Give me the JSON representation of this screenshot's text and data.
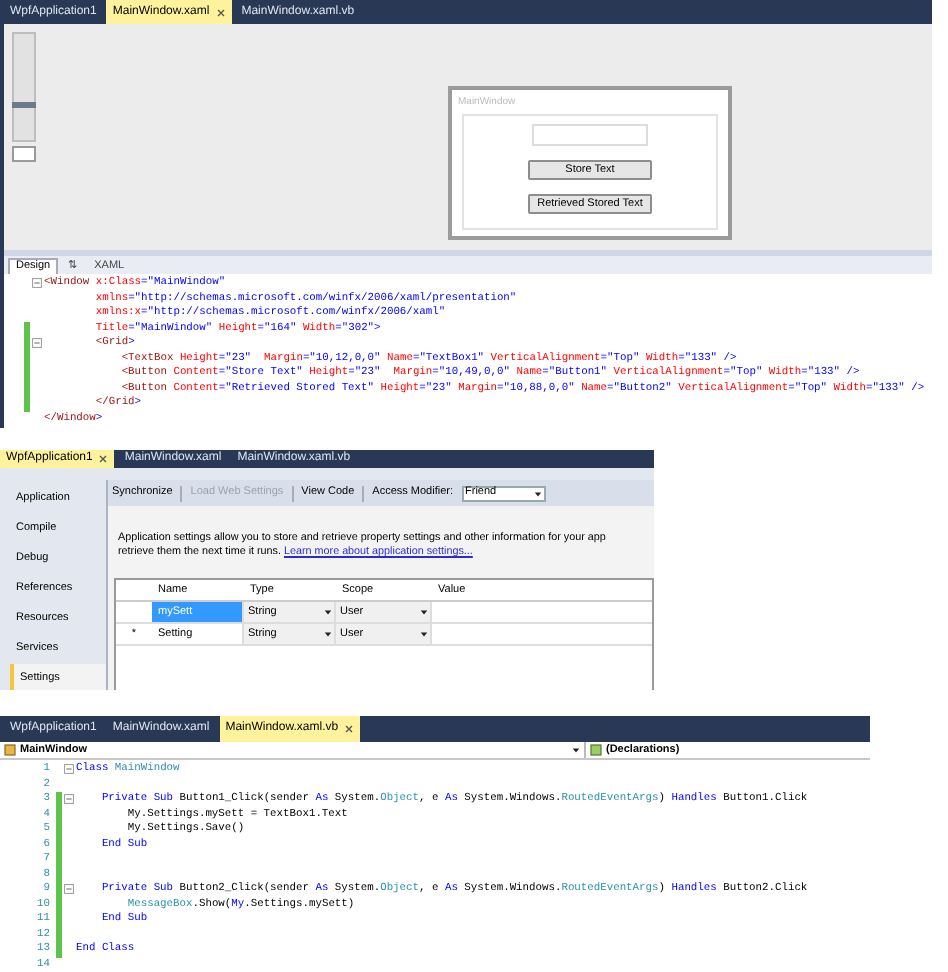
{
  "designer_panel": {
    "tabs": [
      {
        "label": "WpfApplication1",
        "selected": false
      },
      {
        "label": "MainWindow.xaml",
        "selected": true
      },
      {
        "label": "MainWindow.xaml.vb",
        "selected": false
      }
    ],
    "zoom_slider": {
      "level": 0.31
    },
    "design_window": {
      "title": "MainWindow",
      "buttons": [
        "Store Text",
        "Retrieved Stored Text"
      ]
    },
    "view_tabs": [
      {
        "label": "Design",
        "selected": true
      },
      {
        "label": "⇅",
        "selected": false
      },
      {
        "label": "XAML",
        "selected": false
      }
    ],
    "xaml_lines": [
      {
        "outline": true,
        "modified": false,
        "tokens": [
          {
            "kind": "tag",
            "text": "<Window"
          },
          {
            "kind": "attr",
            "text": " x:Class"
          },
          {
            "kind": "value",
            "text": "=\"MainWindow\""
          }
        ]
      },
      {
        "outline": false,
        "modified": false,
        "tokens": [
          {
            "kind": "attr",
            "text": "        xmlns"
          },
          {
            "kind": "value",
            "text": "=\"http://schemas.microsoft.com/winfx/2006/xaml/presentation\""
          }
        ]
      },
      {
        "outline": false,
        "modified": false,
        "tokens": [
          {
            "kind": "attr",
            "text": "        xmlns:x"
          },
          {
            "kind": "value",
            "text": "=\"http://schemas.microsoft.com/winfx/2006/xaml\""
          }
        ]
      },
      {
        "outline": false,
        "modified": true,
        "tokens": [
          {
            "kind": "attr",
            "text": "        Title"
          },
          {
            "kind": "value",
            "text": "=\"MainWindow\""
          },
          {
            "kind": "attr",
            "text": " Height"
          },
          {
            "kind": "value",
            "text": "=\"164\""
          },
          {
            "kind": "attr",
            "text": " Width"
          },
          {
            "kind": "value",
            "text": "=\"302\">"
          }
        ]
      },
      {
        "outline": true,
        "modified": true,
        "tokens": [
          {
            "kind": "tag",
            "text": "        <Grid"
          },
          {
            "kind": "punct",
            "text": ">"
          }
        ]
      },
      {
        "outline": false,
        "modified": true,
        "tokens": [
          {
            "kind": "tag",
            "text": "            <TextBox"
          },
          {
            "kind": "attr",
            "text": " Height"
          },
          {
            "kind": "value",
            "text": "=\"23\""
          },
          {
            "kind": "attr",
            "text": "  Margin"
          },
          {
            "kind": "value",
            "text": "=\"10,12,0,0\""
          },
          {
            "kind": "attr",
            "text": " Name"
          },
          {
            "kind": "value",
            "text": "=\"TextBox1\""
          },
          {
            "kind": "attr",
            "text": " VerticalAlignment"
          },
          {
            "kind": "value",
            "text": "=\"Top\""
          },
          {
            "kind": "attr",
            "text": " Width"
          },
          {
            "kind": "value",
            "text": "=\"133\" />"
          }
        ]
      },
      {
        "outline": false,
        "modified": true,
        "tokens": [
          {
            "kind": "tag",
            "text": "            <Button"
          },
          {
            "kind": "attr",
            "text": " Content"
          },
          {
            "kind": "value",
            "text": "=\"Store Text\""
          },
          {
            "kind": "attr",
            "text": " Height"
          },
          {
            "kind": "value",
            "text": "=\"23\""
          },
          {
            "kind": "attr",
            "text": "  Margin"
          },
          {
            "kind": "value",
            "text": "=\"10,49,0,0\""
          },
          {
            "kind": "attr",
            "text": " Name"
          },
          {
            "kind": "value",
            "text": "=\"Button1\""
          },
          {
            "kind": "attr",
            "text": " VerticalAlignment"
          },
          {
            "kind": "value",
            "text": "=\"Top\""
          },
          {
            "kind": "attr",
            "text": " Width"
          },
          {
            "kind": "value",
            "text": "=\"133\" />"
          }
        ]
      },
      {
        "outline": false,
        "modified": true,
        "tokens": [
          {
            "kind": "tag",
            "text": "            <Button"
          },
          {
            "kind": "attr",
            "text": " Content"
          },
          {
            "kind": "value",
            "text": "=\"Retrieved Stored Text\""
          },
          {
            "kind": "attr",
            "text": " Height"
          },
          {
            "kind": "value",
            "text": "=\"23\""
          },
          {
            "kind": "attr",
            "text": " Margin"
          },
          {
            "kind": "value",
            "text": "=\"10,88,0,0\""
          },
          {
            "kind": "attr",
            "text": " Name"
          },
          {
            "kind": "value",
            "text": "=\"Button2\""
          },
          {
            "kind": "attr",
            "text": " VerticalAlignment"
          },
          {
            "kind": "value",
            "text": "=\"Top\""
          },
          {
            "kind": "attr",
            "text": " Width"
          },
          {
            "kind": "value",
            "text": "=\"133\" />"
          }
        ]
      },
      {
        "outline": false,
        "modified": true,
        "tokens": [
          {
            "kind": "tag",
            "text": "        </Grid"
          },
          {
            "kind": "punct",
            "text": ">"
          }
        ]
      },
      {
        "outline": false,
        "modified": false,
        "tokens": [
          {
            "kind": "tag",
            "text": "</Window"
          },
          {
            "kind": "punct",
            "text": ">"
          }
        ]
      }
    ]
  },
  "settings_panel": {
    "tabs": [
      {
        "label": "WpfApplication1",
        "selected": true
      },
      {
        "label": "MainWindow.xaml",
        "selected": false
      },
      {
        "label": "MainWindow.xaml.vb",
        "selected": false
      }
    ],
    "nav_items": [
      {
        "label": "Application",
        "selected": false
      },
      {
        "label": "Compile",
        "selected": false
      },
      {
        "label": "Debug",
        "selected": false
      },
      {
        "label": "References",
        "selected": false
      },
      {
        "label": "Resources",
        "selected": false
      },
      {
        "label": "Services",
        "selected": false
      },
      {
        "label": "Settings",
        "selected": true
      }
    ],
    "toolbar": {
      "synchronize": "Synchronize",
      "load_web_settings": {
        "label": "Load Web Settings",
        "disabled": true
      },
      "view_code": "View Code",
      "access_modifier_label": "Access Modifier:",
      "access_modifier_value": "Friend"
    },
    "description": {
      "text": "Application settings allow you to store and retrieve property settings and other information for your app retrieve them the next time it runs. ",
      "link": "Learn more about application settings..."
    },
    "grid": {
      "columns": [
        "Name",
        "Type",
        "Scope",
        "Value"
      ],
      "rows": [
        {
          "name": "mySett",
          "type": "String",
          "scope": "User",
          "selected": true
        },
        {
          "marker": "*",
          "name": "Setting",
          "type": "String",
          "scope": "User",
          "selected": false
        }
      ]
    }
  },
  "code_panel": {
    "tabs": [
      {
        "label": "WpfApplication1",
        "selected": false
      },
      {
        "label": "MainWindow.xaml",
        "selected": false
      },
      {
        "label": "MainWindow.xaml.vb",
        "selected": true
      }
    ],
    "class_dropdown": "MainWindow",
    "member_dropdown": "(Declarations)",
    "lines": [
      {
        "number": "1",
        "outline": true,
        "modified": false,
        "tokens": [
          {
            "kind": "kw",
            "text": "Class"
          },
          {
            "kind": "type",
            "text": " MainWindow"
          }
        ]
      },
      {
        "number": "2",
        "outline": false,
        "modified": false
      },
      {
        "number": "3",
        "outline": true,
        "modified": true,
        "tokens": [
          {
            "kind": "kw",
            "text": "    Private Sub"
          },
          {
            "kind": "plain",
            "text": " Button1_Click(sender "
          },
          {
            "kind": "kw",
            "text": "As"
          },
          {
            "kind": "plain",
            "text": " System."
          },
          {
            "kind": "type",
            "text": "Object"
          },
          {
            "kind": "plain",
            "text": ", e "
          },
          {
            "kind": "kw",
            "text": "As"
          },
          {
            "kind": "plain",
            "text": " System.Windows."
          },
          {
            "kind": "type",
            "text": "RoutedEventArgs"
          },
          {
            "kind": "plain",
            "text": ") "
          },
          {
            "kind": "kw",
            "text": "Handles"
          },
          {
            "kind": "plain",
            "text": " Button1.Click"
          }
        ]
      },
      {
        "number": "4",
        "outline": false,
        "modified": true,
        "tokens": [
          {
            "kind": "plain",
            "text": "        My.Settings.mySett = TextBox1.Text"
          }
        ]
      },
      {
        "number": "5",
        "outline": false,
        "modified": true,
        "tokens": [
          {
            "kind": "plain",
            "text": "        My.Settings.Save()"
          }
        ]
      },
      {
        "number": "6",
        "outline": false,
        "modified": true,
        "tokens": [
          {
            "kind": "kw",
            "text": "    End Sub"
          }
        ]
      },
      {
        "number": "7",
        "outline": false,
        "modified": true
      },
      {
        "number": "8",
        "outline": false,
        "modified": true
      },
      {
        "number": "9",
        "outline": true,
        "modified": true,
        "tokens": [
          {
            "kind": "kw",
            "text": "    Private Sub"
          },
          {
            "kind": "plain",
            "text": " Button2_Click(sender "
          },
          {
            "kind": "kw",
            "text": "As"
          },
          {
            "kind": "plain",
            "text": " System."
          },
          {
            "kind": "type",
            "text": "Object"
          },
          {
            "kind": "plain",
            "text": ", e "
          },
          {
            "kind": "kw",
            "text": "As"
          },
          {
            "kind": "plain",
            "text": " System.Windows."
          },
          {
            "kind": "type",
            "text": "RoutedEventArgs"
          },
          {
            "kind": "plain",
            "text": ") "
          },
          {
            "kind": "kw",
            "text": "Handles"
          },
          {
            "kind": "plain",
            "text": " Button2.Click"
          }
        ]
      },
      {
        "number": "10",
        "outline": false,
        "modified": true,
        "tokens": [
          {
            "kind": "type",
            "text": "        MessageBox"
          },
          {
            "kind": "plain",
            "text": ".Show("
          },
          {
            "kind": "kw",
            "text": "My"
          },
          {
            "kind": "plain",
            "text": ".Settings.mySett)"
          }
        ]
      },
      {
        "number": "11",
        "outline": false,
        "modified": true,
        "tokens": [
          {
            "kind": "kw",
            "text": "    End Sub"
          }
        ]
      },
      {
        "number": "12",
        "outline": false,
        "modified": true
      },
      {
        "number": "13",
        "outline": false,
        "modified": true,
        "tokens": [
          {
            "kind": "kw",
            "text": "End Class"
          }
        ]
      },
      {
        "number": "14",
        "outline": false,
        "modified": false
      }
    ]
  }
}
